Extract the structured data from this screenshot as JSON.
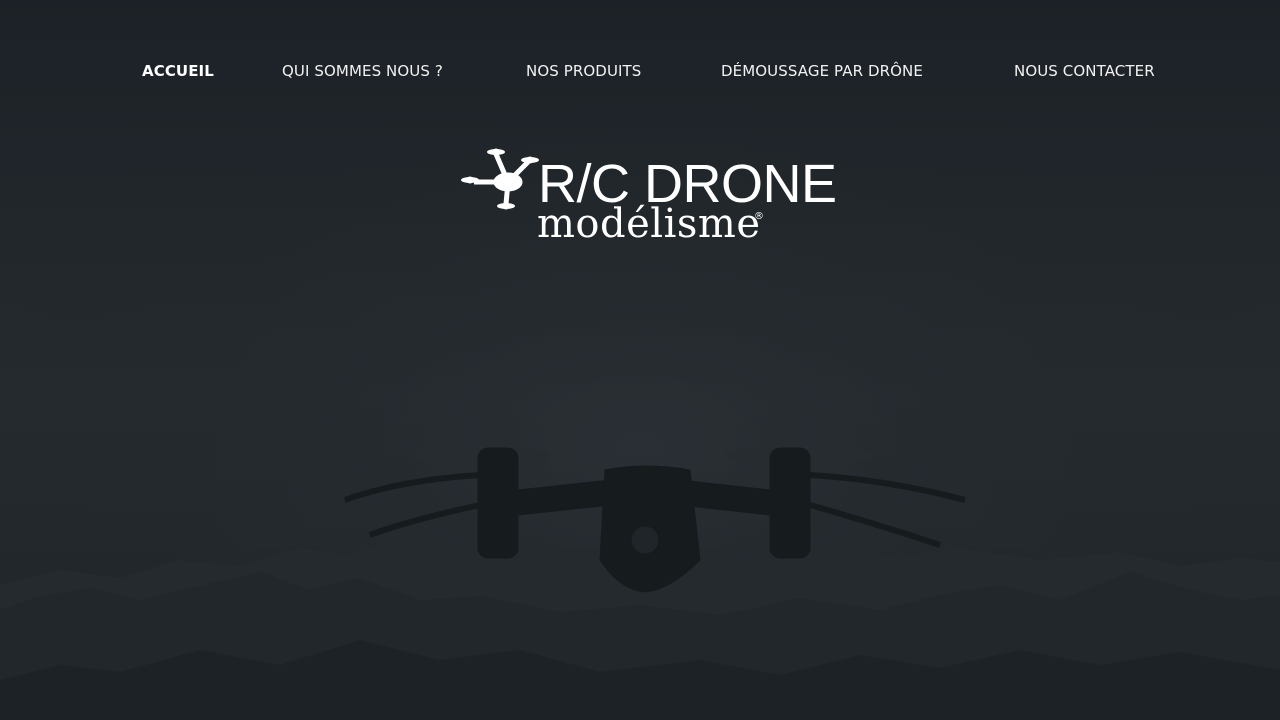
{
  "nav": {
    "items": [
      {
        "label": "ACCUEIL",
        "active": true
      },
      {
        "label": "QUI SOMMES NOUS ?",
        "active": false
      },
      {
        "label": "NOS PRODUITS",
        "active": false
      },
      {
        "label": "DÉMOUSSAGE PAR DRÔNE",
        "active": false
      },
      {
        "label": "NOUS CONTACTER",
        "active": false
      }
    ]
  },
  "logo": {
    "title": "R/C DRONE",
    "subtitle": "modélisme",
    "registered": "®",
    "icon": "quadcopter-icon"
  },
  "hero": {
    "image": "drone-over-mountains-photo"
  },
  "colors": {
    "overlay": "#23282d",
    "text": "#ffffff"
  }
}
